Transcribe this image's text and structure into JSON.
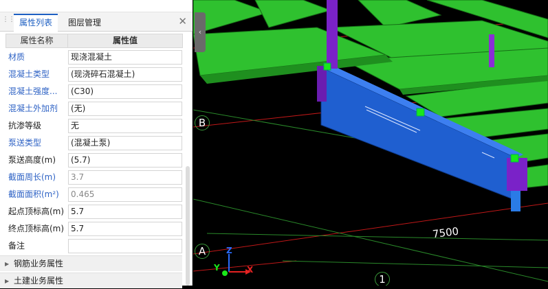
{
  "tabs": [
    {
      "label": "属性列表",
      "active": true
    },
    {
      "label": "图层管理",
      "active": false
    }
  ],
  "table": {
    "header_name": "属性名称",
    "header_value": "属性值"
  },
  "properties": [
    {
      "name": "材质",
      "value": "现浇混凝土",
      "name_color": "blue"
    },
    {
      "name": "混凝土类型",
      "value": "(现浇碎石混凝土)",
      "name_color": "blue"
    },
    {
      "name": "混凝土强度...",
      "value": "(C30)",
      "name_color": "blue"
    },
    {
      "name": "混凝土外加剂",
      "value": "(无)",
      "name_color": "blue"
    },
    {
      "name": "抗渗等级",
      "value": "无",
      "name_color": "dark"
    },
    {
      "name": "泵送类型",
      "value": "(混凝土泵)",
      "name_color": "blue"
    },
    {
      "name": "泵送高度(m)",
      "value": "(5.7)",
      "name_color": "dark"
    },
    {
      "name": "截面周长(m)",
      "value": "3.7",
      "name_color": "blue",
      "value_grey": true
    },
    {
      "name": "截面面积(m²)",
      "value": "0.465",
      "name_color": "blue",
      "value_grey": true
    },
    {
      "name": "起点顶标高(m)",
      "value": "5.7",
      "name_color": "dark"
    },
    {
      "name": "终点顶标高(m)",
      "value": "5.7",
      "name_color": "dark"
    },
    {
      "name": "备注",
      "value": "",
      "name_color": "dark"
    }
  ],
  "groups": [
    {
      "label": "钢筋业务属性"
    },
    {
      "label": "土建业务属性"
    }
  ],
  "viewport": {
    "axis_labels": [
      "B",
      "A",
      "1"
    ],
    "dimension": "7500",
    "gizmo": {
      "x": "X",
      "y": "Y",
      "z": "Z"
    }
  },
  "colors": {
    "slab_green": "#2fc12f",
    "beam_blue": "#1f5fd0",
    "column_purple": "#7a22c8",
    "grid_red": "#c21818",
    "accent": "#1d5fc2"
  },
  "icons": {
    "close": "close-icon",
    "collapse": "chevron-left-icon",
    "grip": "drag-grip-icon",
    "group_expand": "triangle-right-icon"
  }
}
